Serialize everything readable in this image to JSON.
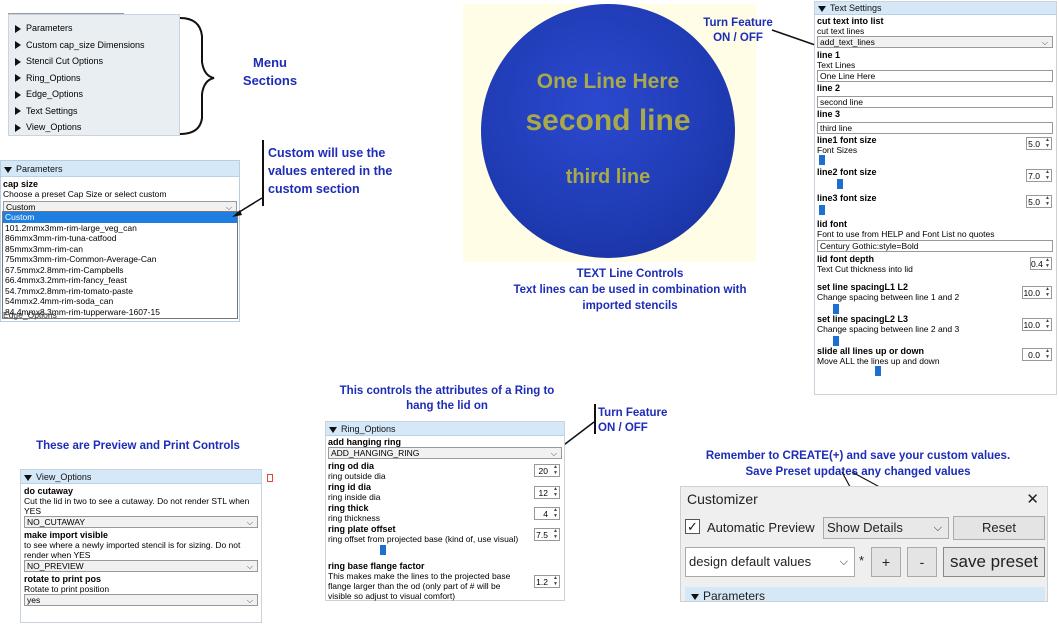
{
  "menu_sections": {
    "items": [
      "Parameters",
      "Custom cap_size Dimensions",
      "Stencil Cut Options",
      "Ring_Options",
      "Edge_Options",
      "Text Settings",
      "View_Options"
    ],
    "annotation": "Menu\nSections"
  },
  "params_panel": {
    "header": "Parameters",
    "cap_size_label": "cap size",
    "cap_size_desc": "Choose a preset Cap Size or select custom",
    "cap_size_value": "Custom",
    "options": [
      "Custom",
      "101.2mmx3mm-rim-large_veg_can",
      "86mmx3mm-rim-tuna-catfood",
      "85mmx3mm-rim-can",
      "75mmx3mm-rim-Common-Average-Can",
      "67.5mmx2.8mm-rim-Campbells",
      "66.4mmx3.2mm-rim-fancy_feast",
      "54.7mmx2.8mm-rim-tomato-paste",
      "54mmx2.4mm-rim-soda_can",
      "84.4mmx8.3mm-rim-tupperware-1607-15"
    ],
    "behind_text": "Edge_Options",
    "annotation": "Custom will use the\nvalues entered in the\ncustom section"
  },
  "preview": {
    "lines": [
      "One Line Here",
      "second line",
      "third line"
    ],
    "circle_color": "#1f3bb3",
    "text_color": "#a9a94a",
    "caption": "TEXT Line Controls\nText lines can be used in combination with\nimported stencils"
  },
  "text_settings": {
    "header": "Text Settings",
    "annotation": "Turn Feature\nON / OFF",
    "cut_label": "cut text into list",
    "cut_desc": "cut text lines",
    "cut_value": "add_text_lines",
    "line1_label": "line 1",
    "line1_desc": "Text Lines",
    "line1_value": "One Line Here",
    "line2_label": "line 2",
    "line2_value": "second line",
    "line3_label": "line 3",
    "line3_value": "third line",
    "l1fs_label": "line1 font size",
    "l1fs_desc": "Font Sizes",
    "l1fs_value": "5.0",
    "l2fs_label": "line2 font size",
    "l2fs_value": "7.0",
    "l3fs_label": "line3 font size",
    "l3fs_value": "5.0",
    "lidfont_label": "lid font",
    "lidfont_desc": "Font to use from HELP and Font List no quotes",
    "lidfont_value": "Century Gothic:style=Bold",
    "depth_label": "lid font depth",
    "depth_desc": "Text Cut thickness into lid",
    "depth_value": "0.4",
    "sp12_label": "set line spacingL1 L2",
    "sp12_desc": "Change spacing between line 1 and 2",
    "sp12_value": "10.0",
    "sp23_label": "set line spacingL2 L3",
    "sp23_desc": "Change spacing between line 2 and 3",
    "sp23_value": "10.0",
    "slide_label": "slide all lines up or down",
    "slide_desc": "Move ALL the lines up and down",
    "slide_value": "0.0"
  },
  "view_options": {
    "annotation": "These are Preview and Print Controls",
    "header": "View_Options",
    "cut_label": "do cutaway",
    "cut_desc": "Cut the lid in two to see a cutaway. Do not render STL when YES",
    "cut_value": "NO_CUTAWAY",
    "imp_label": "make import visible",
    "imp_desc": "to see where a newly imported stencil is for sizing.  Do not render when YES",
    "imp_value": "NO_PREVIEW",
    "rot_label": "rotate to print pos",
    "rot_desc": "Rotate to print position",
    "rot_value": "yes"
  },
  "ring_options": {
    "annotation_top": "This controls the attributes of a Ring to\nhang the lid on",
    "annotation_side": "Turn Feature\nON / OFF",
    "header": "Ring_Options",
    "add_label": "add hanging ring",
    "add_value": "ADD_HANGING_RING",
    "od_label": "ring od dia",
    "od_desc": "ring outside dia",
    "od_value": "20",
    "id_label": "ring id dia",
    "id_desc": "ring inside dia",
    "id_value": "12",
    "thick_label": "ring thick",
    "thick_desc": "ring thickness",
    "thick_value": "4",
    "offset_label": "ring plate offset",
    "offset_desc": "ring offset from projected base (kind of, use visual)",
    "offset_value": "7.5",
    "flange_label": "ring base flange factor",
    "flange_desc": "This makes make the lines to the projected base flange larger than the od  (only part of # will be visible so adjust to visual comfort)",
    "flange_value": "1.2"
  },
  "customizer": {
    "annotation": "Remember to CREATE(+) and save your custom values.\nSave Preset updates any changed values",
    "title": "Customizer",
    "close": "✕",
    "auto_preview_label": "Automatic Preview",
    "auto_preview_checked": "✓",
    "details_value": "Show Details",
    "reset_label": "Reset",
    "preset_value": "design default values",
    "asterisk": "*",
    "plus_label": "+",
    "minus_label": "-",
    "save_label": "save preset",
    "params_header": "Parameters"
  }
}
